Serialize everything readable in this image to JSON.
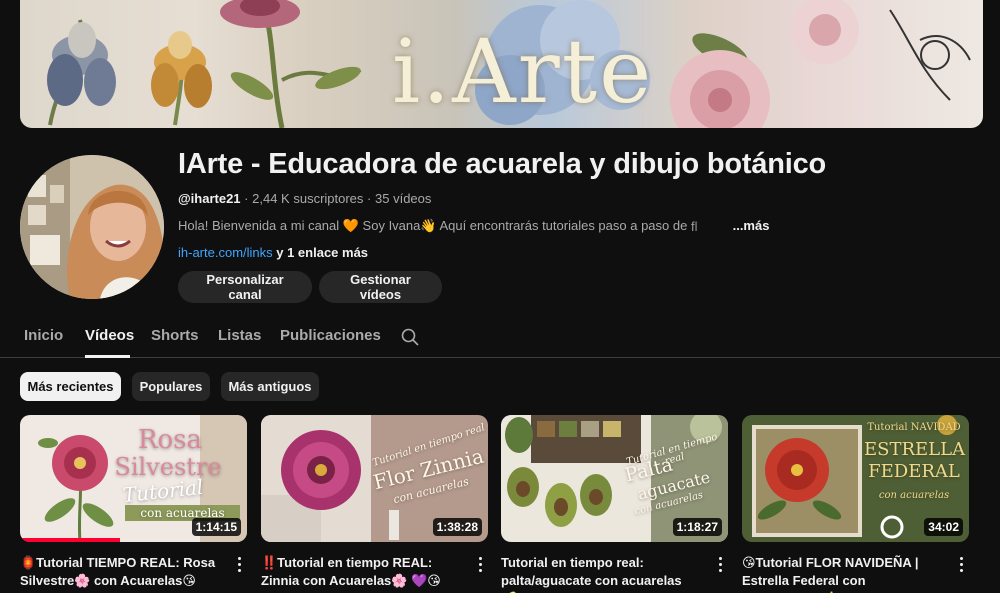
{
  "banner": {
    "logo_text": "i.Arte"
  },
  "channel": {
    "title": "IArte - Educadora de acuarela y dibujo botánico",
    "handle": "@iharte21",
    "subscribers": "2,44 K suscriptores",
    "videos": "35 vídeos",
    "separator": "·",
    "description": "Hola! Bienvenida a mi canal 🧡  Soy Ivana👋  Aquí encontrarás tutoriales paso a paso de",
    "description_fade": "fl",
    "more_label": "...más",
    "link": "ih-arte.com/links",
    "link_extra": " y 1 enlace más"
  },
  "buttons": {
    "customize": "Personalizar canal",
    "manage": "Gestionar vídeos"
  },
  "tabs": [
    {
      "label": "Inicio"
    },
    {
      "label": "Vídeos"
    },
    {
      "label": "Shorts"
    },
    {
      "label": "Listas"
    },
    {
      "label": "Publicaciones"
    }
  ],
  "chips": [
    {
      "label": "Más recientes"
    },
    {
      "label": "Populares"
    },
    {
      "label": "Más antiguos"
    }
  ],
  "videos": [
    {
      "title": "🏮Tutorial TIEMPO REAL: Rosa Silvestre🌸 con Acuarelas😘",
      "duration": "1:14:15",
      "thumb_line1": "Rosa",
      "thumb_line2": "Silvestre",
      "thumb_line3": "Tutorial",
      "thumb_line4": "con acuarelas"
    },
    {
      "title": "‼️Tutorial en tiempo REAL: Zinnia con Acuarelas🌸 💜😘",
      "duration": "1:38:28",
      "thumb_line1": "Tutorial en tiempo real",
      "thumb_line2": "Flor Zinnia",
      "thumb_line3": "con acuarelas"
    },
    {
      "title": "Tutorial en tiempo real: palta/aguacate con acuarelas🥑...",
      "duration": "1:18:27",
      "thumb_line1": "Tutorial en tiempo real",
      "thumb_line2": "Palta",
      "thumb_line3": "aguacate",
      "thumb_line4": "con acuarelas"
    },
    {
      "title": "😘Tutorial FLOR NAVIDEÑA | Estrella Federal con ACUARELAS🎄",
      "duration": "34:02",
      "thumb_line1": "Tutorial NAVIDAD",
      "thumb_line2": "ESTRELLA",
      "thumb_line3": "FEDERAL",
      "thumb_line4": "con acuarelas"
    }
  ],
  "colors": {
    "background": "#0f0f0f",
    "link": "#3ea6ff",
    "progress": "#ff0033",
    "chip": "#272727"
  }
}
